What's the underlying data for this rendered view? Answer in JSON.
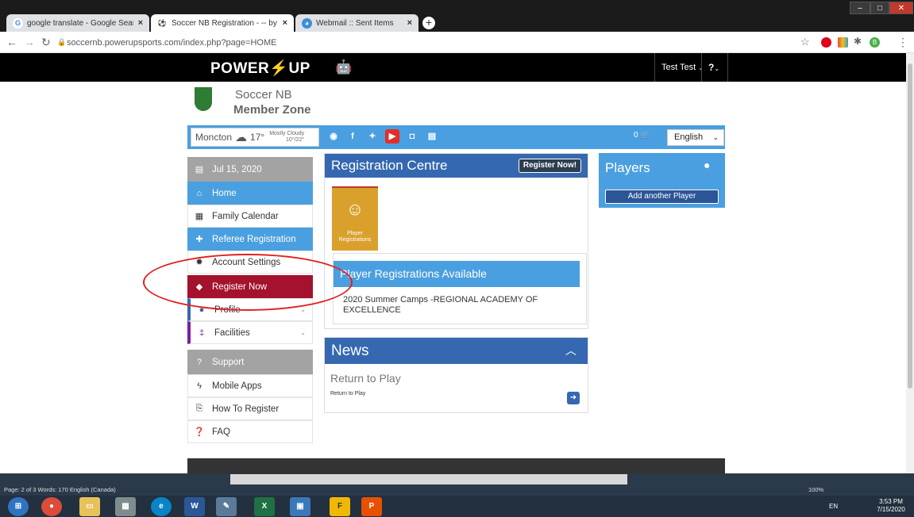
{
  "browser": {
    "tabs": [
      {
        "label": "google translate - Google Search",
        "icon": "G"
      },
      {
        "label": "Soccer NB Registration - -- by Po",
        "icon": "⚽"
      },
      {
        "label": "Webmail :: Sent Items",
        "icon": "◕"
      }
    ],
    "tab_close": "×",
    "new_tab": "+",
    "url": "soccernb.powerupsports.com/index.php?page=HOME",
    "profile_initial": "B"
  },
  "header": {
    "logo_text_1": "POWER",
    "logo_bolt": "⚡",
    "logo_text_2": "UP",
    "user": "Test Test",
    "help": "?"
  },
  "org": {
    "line1": "Soccer NB",
    "line2": "Member Zone"
  },
  "infobar": {
    "city": "Moncton",
    "temp": "17°",
    "condition": "Mostly Cloudy",
    "range": "10°/22°",
    "cart_count": "0",
    "language": "English"
  },
  "sidebar": {
    "items": [
      {
        "label": "Jul 15, 2020",
        "icon": "calendar-icon"
      },
      {
        "label": "Home",
        "icon": "home-icon"
      },
      {
        "label": "Family Calendar",
        "icon": "calendar-grid-icon"
      },
      {
        "label": "Referee Registration",
        "icon": "clipboard-plus-icon"
      },
      {
        "label": "Account Settings",
        "icon": "gear-icon"
      },
      {
        "label": "Register Now",
        "icon": "tag-icon"
      },
      {
        "label": "Profile",
        "icon": "user-icon"
      },
      {
        "label": "Facilities",
        "icon": "facility-icon"
      },
      {
        "label": "Support",
        "icon": "help-circle-icon"
      },
      {
        "label": "Mobile Apps",
        "icon": "bolt-icon"
      },
      {
        "label": "How To Register",
        "icon": "pdf-icon"
      },
      {
        "label": "FAQ",
        "icon": "question-icon"
      }
    ]
  },
  "registration": {
    "title": "Registration Centre",
    "button": "Register Now!",
    "tile_label": "Player Registrations",
    "available_title": "Player Registrations Available",
    "available_item": "2020 Summer Camps -REGIONAL ACADEMY OF EXCELLENCE"
  },
  "news": {
    "title": "News",
    "item_title": "Return to Play",
    "item_sub": "Return to Play"
  },
  "players": {
    "title": "Players",
    "add_button": "Add another Player"
  },
  "word_status": {
    "text": "Page: 2 of 3   Words: 170     English (Canada)",
    "zoom": "100%"
  },
  "taskbar": {
    "lang": "EN",
    "time": "3:53 PM",
    "date": "7/15/2020"
  },
  "colors": {
    "accent_blue": "#4a9fe0",
    "panel_blue": "#3568b0",
    "register_red": "#a4122d",
    "annotation_red": "#e02020"
  }
}
